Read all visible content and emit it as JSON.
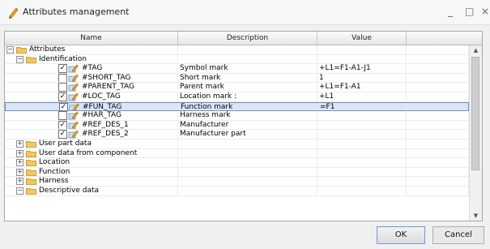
{
  "window": {
    "title": "Attributes management",
    "minimize": "_",
    "maximize": "□",
    "close": "×"
  },
  "columns": {
    "name": "Name",
    "description": "Description",
    "value": "Value"
  },
  "rows": [
    {
      "label": "Attributes",
      "description": "",
      "value": "",
      "level": 0,
      "type": "folder",
      "expander": "−"
    },
    {
      "label": "Identification",
      "description": "",
      "value": "",
      "level": 1,
      "type": "folder",
      "expander": "−"
    },
    {
      "label": "#TAG",
      "description": "Symbol mark",
      "value": "+L1=F1-A1-J1",
      "level": 2,
      "type": "attr",
      "checked": true
    },
    {
      "label": "#SHORT_TAG",
      "description": "Short mark",
      "value": "1",
      "level": 2,
      "type": "attr",
      "checked": false
    },
    {
      "label": "#PARENT_TAG",
      "description": "Parent mark",
      "value": "+L1=F1-A1",
      "level": 2,
      "type": "attr",
      "checked": false
    },
    {
      "label": "#LOC_TAG",
      "description": "Location mark :",
      "value": "+L1",
      "level": 2,
      "type": "attr",
      "checked": true
    },
    {
      "label": "#FUN_TAG",
      "description": "Function mark",
      "value": "=F1",
      "level": 2,
      "type": "attr",
      "checked": true,
      "selected": true
    },
    {
      "label": "#HAR_TAG",
      "description": "Harness mark",
      "value": "",
      "level": 2,
      "type": "attr",
      "checked": false
    },
    {
      "label": "#REF_DES_1",
      "description": "Manufacturer",
      "value": "",
      "level": 2,
      "type": "attr",
      "checked": true
    },
    {
      "label": "#REF_DES_2",
      "description": "Manufacturer part",
      "value": "",
      "level": 2,
      "type": "attr",
      "checked": true
    },
    {
      "label": "User part data",
      "description": "",
      "value": "",
      "level": 1,
      "type": "folder",
      "expander": "+"
    },
    {
      "label": "User data from component",
      "description": "",
      "value": "",
      "level": 1,
      "type": "folder",
      "expander": "+"
    },
    {
      "label": "Location",
      "description": "",
      "value": "",
      "level": 1,
      "type": "folder",
      "expander": "+"
    },
    {
      "label": "Function",
      "description": "",
      "value": "",
      "level": 1,
      "type": "folder",
      "expander": "+"
    },
    {
      "label": "Harness",
      "description": "",
      "value": "",
      "level": 1,
      "type": "folder",
      "expander": "+"
    },
    {
      "label": "Descriptive data",
      "description": "",
      "value": "",
      "level": 1,
      "type": "folder",
      "expander": "−"
    }
  ],
  "buttons": {
    "ok": "OK",
    "cancel": "Cancel"
  },
  "icons": {
    "app": "pencil-icon",
    "folder": "folder-icon",
    "attribute": "tag-pencil-icon"
  },
  "colors": {
    "selection": "#dbe6f4",
    "folder": "#f3c85a"
  }
}
